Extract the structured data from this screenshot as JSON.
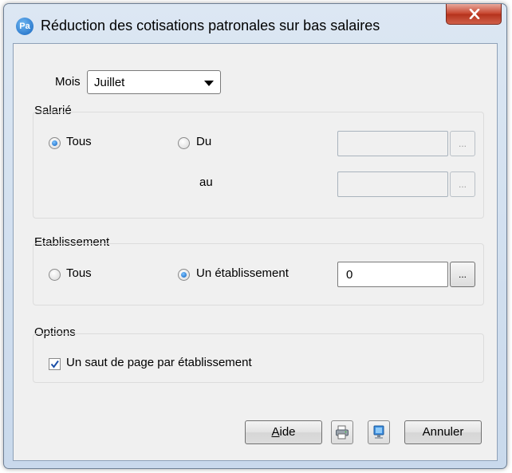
{
  "window": {
    "app_icon_text": "Pa",
    "title": "Réduction des cotisations patronales sur bas salaires"
  },
  "mois": {
    "label": "Mois",
    "selected": "Juillet"
  },
  "salarie": {
    "title": "Salarié",
    "radio_tous": "Tous",
    "radio_du": "Du",
    "label_au": "au",
    "du_value": "",
    "au_value": "",
    "selected": "Tous"
  },
  "etablissement": {
    "title": "Etablissement",
    "radio_tous": "Tous",
    "radio_un": "Un établissement",
    "value": "0",
    "selected": "Un établissement"
  },
  "options": {
    "title": "Options",
    "checkbox_label": "Un saut de page par établissement",
    "checked": true
  },
  "buttons": {
    "aide_prefix": "A",
    "aide_rest": "ide",
    "annuler": "Annuler",
    "ellipsis": "..."
  },
  "colors": {
    "accent": "#0b5fbf",
    "close": "#c7462f"
  }
}
